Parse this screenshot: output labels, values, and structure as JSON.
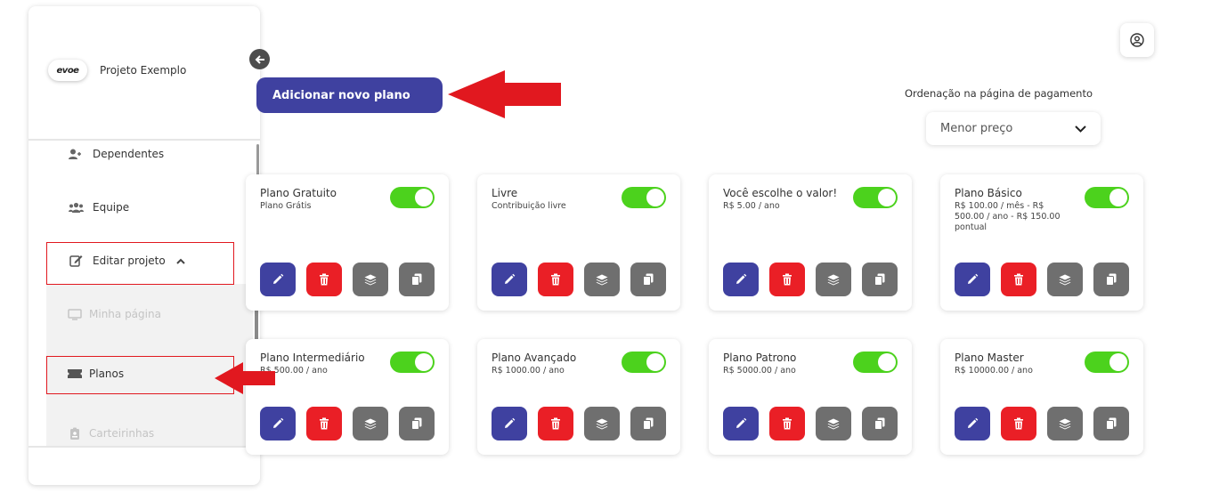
{
  "sidebar": {
    "logo_text": "evoe",
    "project_name": "Projeto Exemplo",
    "items": [
      {
        "label": "Dependentes"
      },
      {
        "label": "Equipe"
      },
      {
        "label": "Editar projeto"
      }
    ],
    "sub_items": [
      {
        "label": "Minha página"
      },
      {
        "label": "Planos"
      },
      {
        "label": "Carteirinhas"
      }
    ]
  },
  "header": {
    "add_button_label": "Adicionar novo plano",
    "order_label": "Ordenação na página de pagamento",
    "order_value": "Menor preço"
  },
  "plans": [
    {
      "title": "Plano Gratuito",
      "desc": "Plano Grátis",
      "enabled": true
    },
    {
      "title": "Livre",
      "desc": "Contribuição livre",
      "enabled": true
    },
    {
      "title": "Você escolhe o valor!",
      "desc": "R$ 5.00 / ano",
      "enabled": true
    },
    {
      "title": "Plano Básico",
      "desc": "R$ 100.00 / mês - R$ 500.00 / ano - R$ 150.00 pontual",
      "enabled": true
    },
    {
      "title": "Plano Intermediário",
      "desc": "R$ 500.00 / ano",
      "enabled": true
    },
    {
      "title": "Plano Avançado",
      "desc": "R$ 1000.00 / ano",
      "enabled": true
    },
    {
      "title": "Plano Patrono",
      "desc": "R$ 5000.00 / ano",
      "enabled": true
    },
    {
      "title": "Plano Master",
      "desc": "R$ 10000.00 / ano",
      "enabled": true
    }
  ],
  "colors": {
    "primary": "#3f41a0",
    "danger": "#ea1f26",
    "neutral": "#6f6f6f",
    "toggle_on": "#4cd21d",
    "highlight": "#e1181f"
  }
}
